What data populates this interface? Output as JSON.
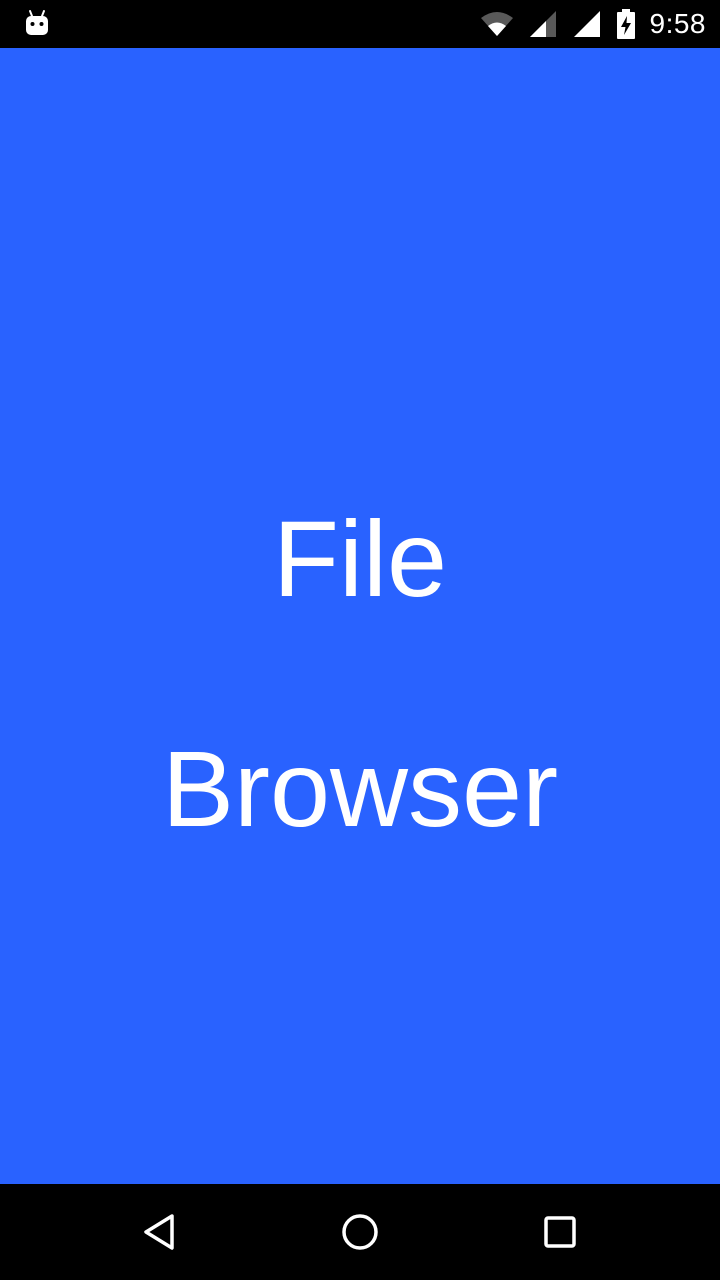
{
  "status_bar": {
    "time": "9:58",
    "left_icon": "android-debug-icon",
    "icons": [
      "wifi-icon",
      "signal-icon",
      "signal-icon",
      "battery-charging-icon"
    ]
  },
  "splash": {
    "title_line1": "File",
    "title_line2": "Browser",
    "background_color": "#2962ff",
    "text_color": "#ffffff"
  },
  "nav_bar": {
    "buttons": [
      "back-icon",
      "home-icon",
      "recents-icon"
    ]
  }
}
